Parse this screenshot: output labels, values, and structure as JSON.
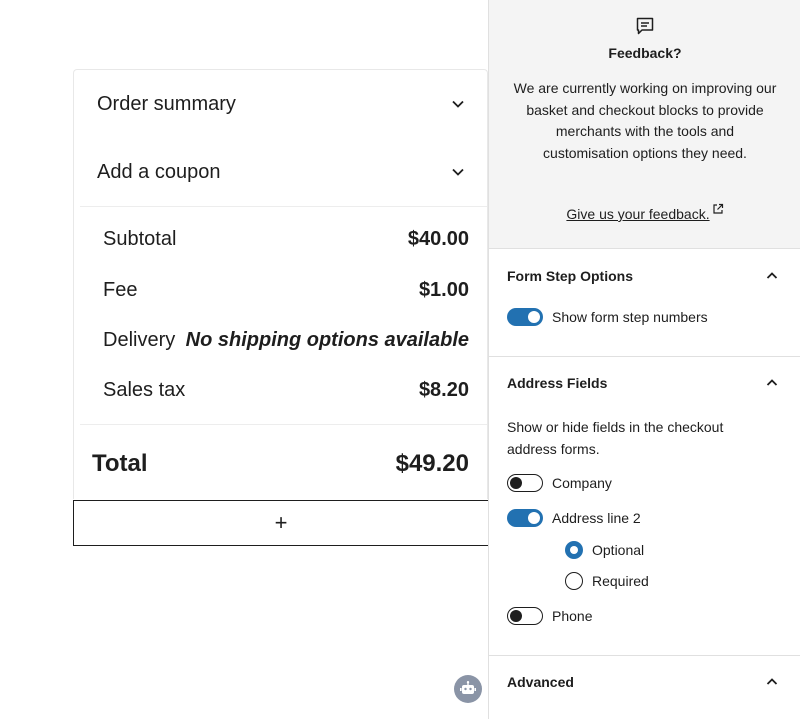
{
  "order_summary": {
    "title": "Order summary",
    "coupon_label": "Add a coupon",
    "lines": [
      {
        "label": "Subtotal",
        "value": "$40.00"
      },
      {
        "label": "Fee",
        "value": "$1.00"
      },
      {
        "label": "Delivery",
        "value": "No shipping options available"
      },
      {
        "label": "Sales tax",
        "value": "$8.20"
      }
    ],
    "total_label": "Total",
    "total_value": "$49.20",
    "add_block_label": "+"
  },
  "feedback": {
    "title": "Feedback?",
    "text": "We are currently working on improving our basket and checkout blocks to provide merchants with the tools and customisation options they need.",
    "link": "Give us your feedback."
  },
  "form_step_options": {
    "title": "Form Step Options",
    "show_step_numbers": {
      "label": "Show form step numbers",
      "checked": true
    }
  },
  "address_fields": {
    "title": "Address Fields",
    "description": "Show or hide fields in the checkout address forms.",
    "company": {
      "label": "Company",
      "checked": false
    },
    "address_line_2": {
      "label": "Address line 2",
      "checked": true
    },
    "radio_options": [
      {
        "label": "Optional",
        "checked": true
      },
      {
        "label": "Required",
        "checked": false
      }
    ],
    "phone": {
      "label": "Phone",
      "checked": false
    }
  },
  "advanced": {
    "title": "Advanced"
  },
  "colors": {
    "accent": "#2271b1",
    "sidebar_bg": "#f4f4f4",
    "text": "#1e1e1e"
  },
  "icons": {
    "feedback": "comment-icon",
    "accordion": "chevron-down-icon",
    "panel": "chevron-up-icon",
    "external": "external-link-icon",
    "bot": "bot-icon"
  }
}
